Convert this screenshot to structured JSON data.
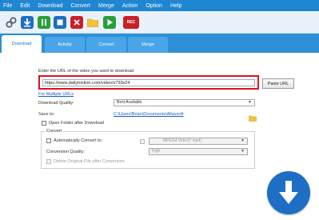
{
  "menu": [
    "File",
    "Edit",
    "Download",
    "Convert",
    "Merge",
    "Action",
    "Option",
    "Help"
  ],
  "toolbar": {
    "rec_label": "REC",
    "icons": [
      "link-icon",
      "download-icon",
      "pause-icon",
      "stop-icon",
      "delete-icon",
      "folder-icon",
      "play-icon",
      "record-icon"
    ]
  },
  "tabs": [
    {
      "label": "Download",
      "active": true
    },
    {
      "label": "Activity",
      "active": false
    },
    {
      "label": "Convert",
      "active": false
    },
    {
      "label": "Merge",
      "active": false
    }
  ],
  "download": {
    "url_prompt": "Enter the URL of the video you want to download",
    "url_value": "https://www.dailymotion.com/video/x730x24",
    "paste_label": "Paste URL",
    "multiple_link": "For Multiple URLs",
    "quality_label": "Download Quality:",
    "quality_value": "Best Available",
    "save_label": "Save to:",
    "save_path": "C:\\Users\\Brian\\Documents\\Allavsoft",
    "open_folder_label": "Open Folder after Download"
  },
  "convert": {
    "group_title": "Convert",
    "auto_label": "Automatically Convert to:",
    "format_value": "MPEG4 Video(*.mp4)",
    "quality_label": "Conversion Quality:",
    "quality_value": "High",
    "delete_label": "Delete Original File after Conversion"
  },
  "colors": {
    "menubar": "#1f86d2",
    "tabstrip": "#2f8fd6",
    "url_highlight": "#e0121e",
    "download_button": "#1e6fc4"
  }
}
